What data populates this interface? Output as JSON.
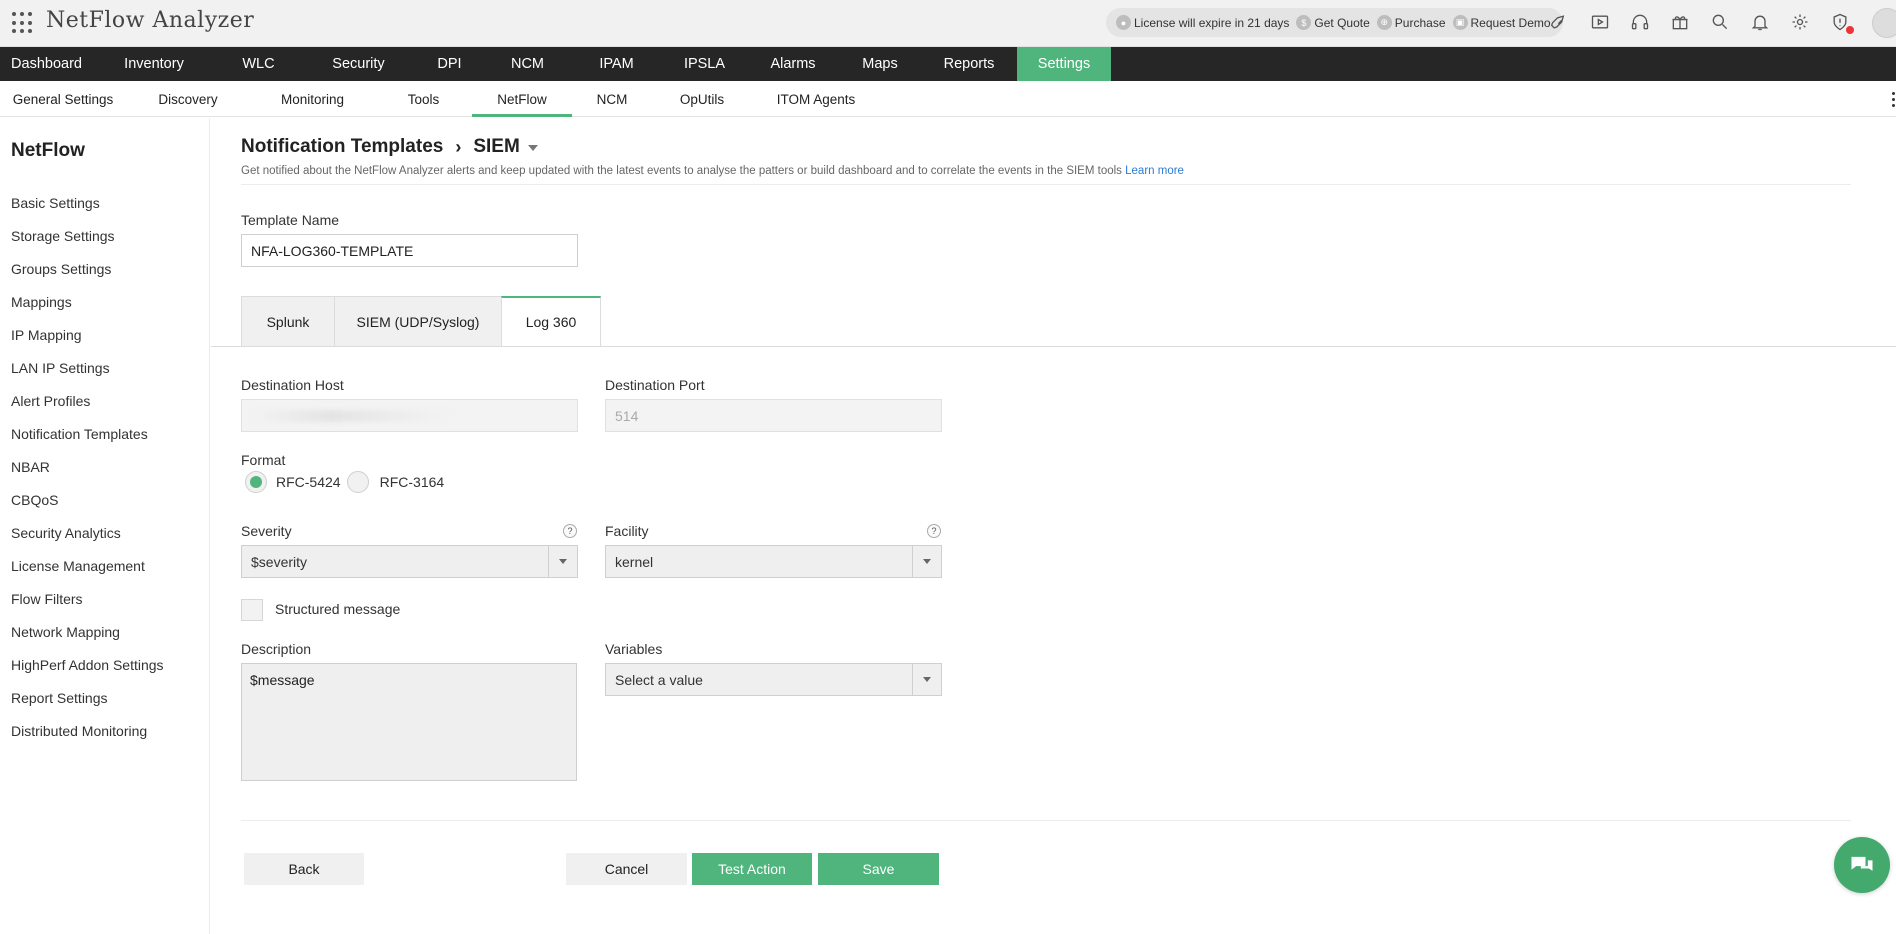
{
  "app": {
    "title": "NetFlow Analyzer"
  },
  "promo": {
    "license": "License will expire in 21 days",
    "quote": "Get Quote",
    "purchase": "Purchase",
    "demo": "Request Demo"
  },
  "toolbar_icons": [
    "rocket-icon",
    "video-icon",
    "headset-icon",
    "gift-icon",
    "search-icon",
    "bell-icon",
    "gear-icon",
    "alert-shield-icon"
  ],
  "mainnav": [
    {
      "label": "Dashboard",
      "w": 93
    },
    {
      "label": "Inventory",
      "w": 122
    },
    {
      "label": "WLC",
      "w": 87
    },
    {
      "label": "Security",
      "w": 113
    },
    {
      "label": "DPI",
      "w": 69
    },
    {
      "label": "NCM",
      "w": 87
    },
    {
      "label": "IPAM",
      "w": 91
    },
    {
      "label": "IPSLA",
      "w": 85
    },
    {
      "label": "Alarms",
      "w": 92
    },
    {
      "label": "Maps",
      "w": 82
    },
    {
      "label": "Reports",
      "w": 96
    },
    {
      "label": "Settings",
      "w": 94
    }
  ],
  "subnav": [
    {
      "label": "General Settings"
    },
    {
      "label": "Discovery"
    },
    {
      "label": "Monitoring"
    },
    {
      "label": "Tools"
    },
    {
      "label": "NetFlow"
    },
    {
      "label": "NCM"
    },
    {
      "label": "OpUtils"
    },
    {
      "label": "ITOM Agents"
    }
  ],
  "sidebar": {
    "title": "NetFlow",
    "items": [
      "Basic Settings",
      "Storage Settings",
      "Groups Settings",
      "Mappings",
      "IP Mapping",
      "LAN IP Settings",
      "Alert Profiles",
      "Notification Templates",
      "NBAR",
      "CBQoS",
      "Security Analytics",
      "License Management",
      "Flow Filters",
      "Network Mapping",
      "HighPerf Addon Settings",
      "Report Settings",
      "Distributed Monitoring"
    ]
  },
  "page": {
    "crumb_parent": "Notification Templates",
    "crumb_sep": "›",
    "crumb_current": "SIEM",
    "description": "Get notified about the NetFlow Analyzer alerts and keep updated with the latest events to analyse the patters or build dashboard and to correlate the events in the SIEM tools",
    "learn_more": "Learn more"
  },
  "form": {
    "template_name_label": "Template Name",
    "template_name_value": "NFA-LOG360-TEMPLATE",
    "tabs": [
      "Splunk",
      "SIEM (UDP/Syslog)",
      "Log 360"
    ],
    "dest_host_label": "Destination Host",
    "dest_port_label": "Destination Port",
    "dest_port_value": "514",
    "format_label": "Format",
    "format_options": [
      "RFC-5424",
      "RFC-3164"
    ],
    "severity_label": "Severity",
    "severity_value": "$severity",
    "facility_label": "Facility",
    "facility_value": "kernel",
    "help_glyph": "?",
    "structured_label": "Structured message",
    "description_label": "Description",
    "description_value": "$message",
    "variables_label": "Variables",
    "variables_value": "Select a value"
  },
  "buttons": {
    "back": "Back",
    "cancel": "Cancel",
    "test": "Test Action",
    "save": "Save"
  },
  "colors": {
    "accent": "#4fb57d",
    "nav_bg": "#262626",
    "link": "#2c7bd6"
  }
}
